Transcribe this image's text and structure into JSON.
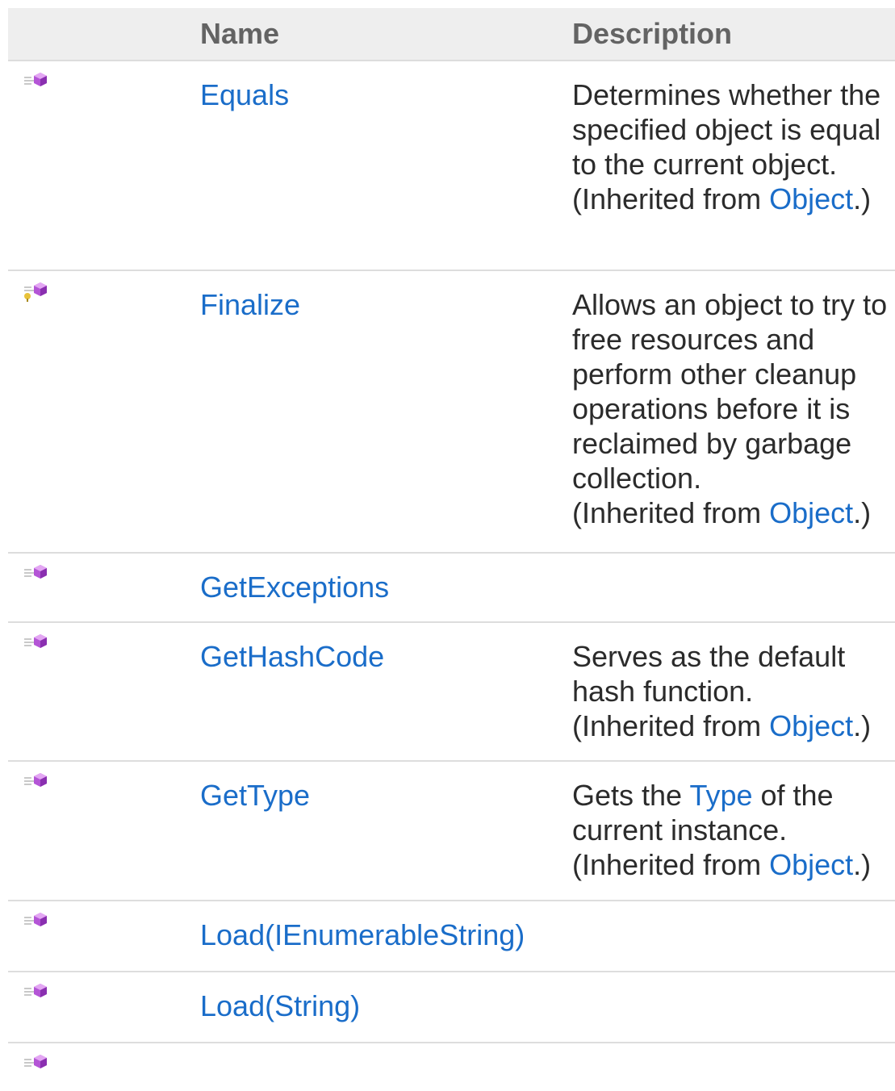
{
  "header": {
    "icon_col": "",
    "name_col": "Name",
    "desc_col": "Description"
  },
  "rows": [
    {
      "icon": "public-method-icon",
      "name": "Equals",
      "desc": "Determines whether the specified object is equal to the current object.",
      "inherited_prefix": "(Inherited from ",
      "inherited_link": "Object",
      "inherited_suffix": ".)"
    },
    {
      "icon": "protected-method-icon",
      "name": "Finalize",
      "desc": "Allows an object to try to free resources and perform other cleanup operations before it is reclaimed by garbage collection.",
      "inherited_prefix": "(Inherited from ",
      "inherited_link": "Object",
      "inherited_suffix": ".)"
    },
    {
      "icon": "public-method-icon",
      "name": "GetExceptions",
      "desc": ""
    },
    {
      "icon": "public-method-icon",
      "name": "GetHashCode",
      "desc": "Serves as the default hash function.",
      "inherited_prefix": "(Inherited from ",
      "inherited_link": "Object",
      "inherited_suffix": ".)"
    },
    {
      "icon": "public-method-icon",
      "name": "GetType",
      "desc_prefix": "Gets the ",
      "desc_link": "Type",
      "desc_suffix": " of the current instance.",
      "inherited_prefix": "(Inherited from ",
      "inherited_link": "Object",
      "inherited_suffix": ".)"
    },
    {
      "icon": "public-method-icon",
      "name": "Load(IEnumerableString)",
      "desc": ""
    },
    {
      "icon": "public-method-icon",
      "name": "Load(String)",
      "desc": ""
    },
    {
      "icon": "public-method-icon",
      "name": "",
      "desc": ""
    }
  ],
  "colors": {
    "link": "#1a6dc9",
    "header_bg": "#eeeeee",
    "header_text": "#636363",
    "divider": "#dddddd",
    "icon_gem": "#b455d6"
  }
}
